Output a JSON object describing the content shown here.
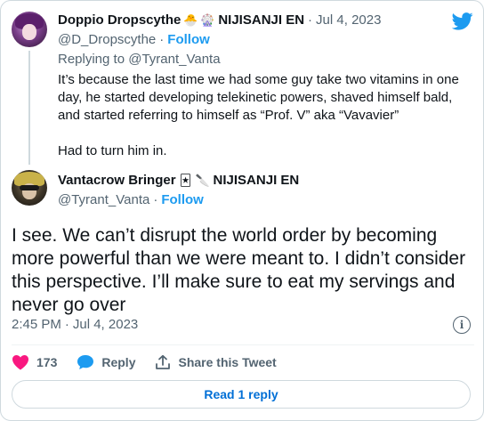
{
  "parent": {
    "display_name": "Doppio Dropscythe",
    "emojis": [
      "🐣",
      "🎡"
    ],
    "affiliation": "NIJISANJI EN",
    "date": "Jul 4, 2023",
    "handle": "@D_Dropscythe",
    "follow_label": "Follow",
    "replying_to_prefix": "Replying to",
    "replying_to_handle": "@Tyrant_Vanta",
    "text_p1": "It’s because the last time we had some guy take two vitamins in one day, he started developing telekinetic powers, shaved himself bald, and started referring to himself as “Prof. V” aka “Vavavier”",
    "text_p2": "Had to turn him in."
  },
  "tweet": {
    "display_name": "Vantacrow Bringer",
    "emojis": [
      "🃏",
      "🔪"
    ],
    "affiliation": "NIJISANJI EN",
    "handle": "@Tyrant_Vanta",
    "follow_label": "Follow",
    "text": "I see. We can’t disrupt the world order by becoming more powerful than we were meant to. I didn’t consider this perspective. I’ll make sure to eat my servings and never go over",
    "time": "2:45 PM",
    "date": "Jul 4, 2023",
    "separator": "·",
    "info_glyph": "i"
  },
  "actions": {
    "likes_count": "173",
    "reply_label": "Reply",
    "share_label": "Share this Tweet"
  },
  "read_replies_label": "Read 1 reply",
  "icons": {
    "logo": "twitter-bird-icon",
    "like": "heart-icon",
    "reply": "speech-bubble-icon",
    "share": "share-arrow-icon",
    "info": "info-icon"
  },
  "colors": {
    "accent": "#1d9bf0",
    "like": "#f91880",
    "read_reply": "#006fd6",
    "secondary_text": "#536471"
  }
}
